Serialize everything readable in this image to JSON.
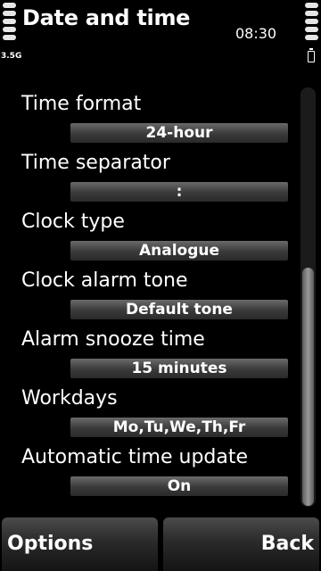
{
  "status_bar": {
    "title": "Date and time",
    "time": "08:30",
    "network": "3.5G"
  },
  "settings": [
    {
      "label": "Time format",
      "value": "24-hour"
    },
    {
      "label": "Time separator",
      "value": ":"
    },
    {
      "label": "Clock type",
      "value": "Analogue"
    },
    {
      "label": "Clock alarm tone",
      "value": "Default tone"
    },
    {
      "label": "Alarm snooze time",
      "value": "15 minutes"
    },
    {
      "label": "Workdays",
      "value": "Mo,Tu,We,Th,Fr"
    },
    {
      "label": "Automatic time update",
      "value": "On"
    }
  ],
  "softkeys": {
    "left": "Options",
    "right": "Back"
  }
}
